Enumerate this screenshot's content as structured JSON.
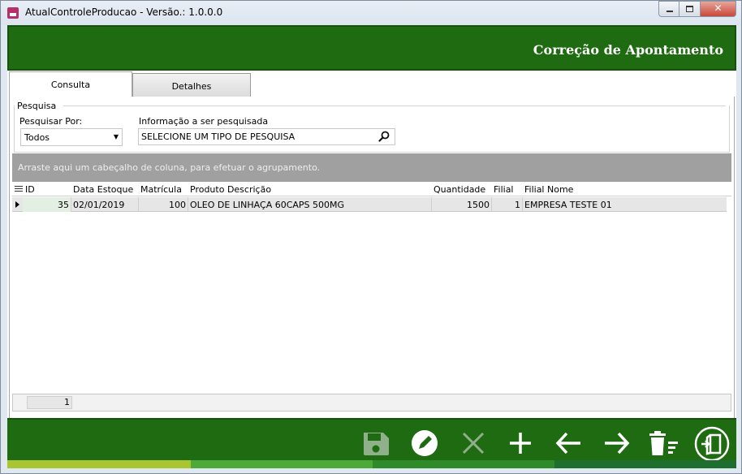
{
  "window": {
    "title": "AtualControleProducao - Versão.: 1.0.0.0"
  },
  "header": {
    "title": "Correção de Apontamento"
  },
  "tabs": [
    {
      "label": "Consulta",
      "active": true
    },
    {
      "label": "Detalhes",
      "active": false
    }
  ],
  "search": {
    "group_label": "Pesquisa",
    "search_by_label": "Pesquisar Por:",
    "search_by_value": "Todos",
    "info_label": "Informação a ser pesquisada",
    "info_value": "SELECIONE UM TIPO DE PESQUISA"
  },
  "grid": {
    "group_hint": "Arraste aqui um cabeçalho de coluna, para efetuar o agrupamento.",
    "columns": [
      "ID",
      "Data Estoque",
      "Matrícula",
      "Produto Descrição",
      "Quantidade",
      "Filial",
      "Filial Nome"
    ],
    "rows": [
      {
        "id": "35",
        "data_estoque": "02/01/2019",
        "matricula": "100",
        "produto_descricao": "OLEO DE LINHAÇA 60CAPS 500MG",
        "quantidade": "1500",
        "filial": "1",
        "filial_nome": "EMPRESA TESTE 01"
      }
    ],
    "footer_count": "1"
  },
  "toolbar": {
    "buttons": [
      "save-icon",
      "edit-icon",
      "cancel-icon",
      "add-icon",
      "previous-icon",
      "next-icon",
      "delete-icon",
      "exit-icon"
    ]
  },
  "colors": {
    "header_green": "#1f6b12",
    "stripe": [
      "#a9c52f",
      "#4daa3a",
      "#2f8a2a",
      "#1e6e2f"
    ]
  }
}
